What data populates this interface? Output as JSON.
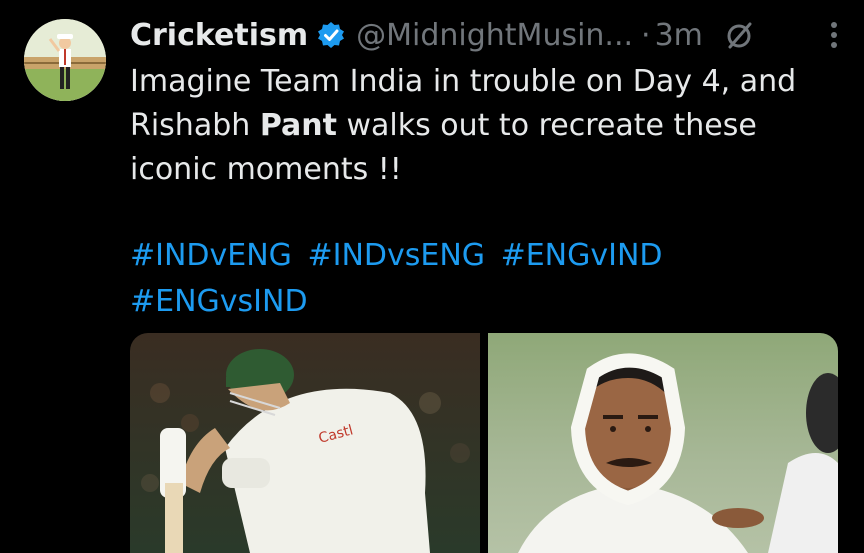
{
  "author": {
    "name": "Cricketism",
    "handle": "@MidnightMusin...",
    "time": "3m",
    "verified_color": "#1d9bf0",
    "avatar_icon": "umpire-avatar"
  },
  "tweet": {
    "line1": "Imagine Team India in trouble on Day 4, and",
    "line2_prefix": "Rishabh ",
    "line2_bold": "Pant",
    "line2_suffix": " walks out to recreate these",
    "line3": "iconic moments !!",
    "hashtags": [
      "#INDvENG",
      "#INDvsENG",
      "#ENGvIND",
      "#ENGvsIND"
    ]
  },
  "media": {
    "left_logo_text": "Castl",
    "left_icon": "batsman-photo",
    "right_icon": "bandaged-bowler-photo"
  },
  "colors": {
    "background": "#000000",
    "text": "#e7e9ea",
    "muted": "#71767b",
    "link": "#1d9bf0"
  }
}
